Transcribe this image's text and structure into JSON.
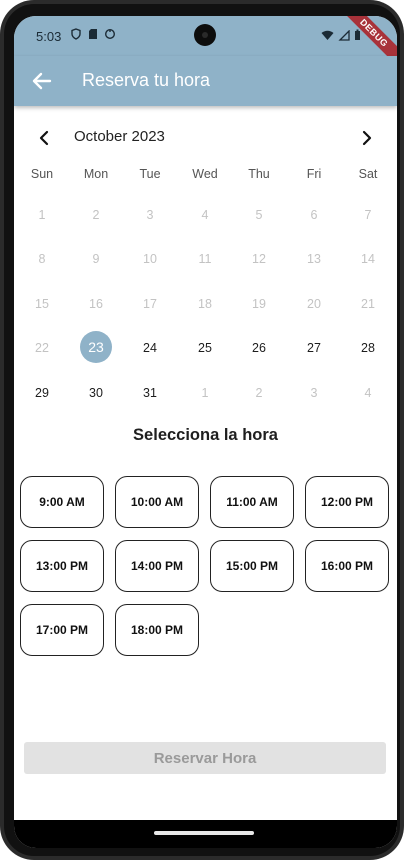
{
  "status_bar": {
    "time": "5:03",
    "debug_label": "DEBUG"
  },
  "app_bar": {
    "title": "Reserva tu hora"
  },
  "calendar": {
    "month_label": "October 2023",
    "weekdays": [
      "Sun",
      "Mon",
      "Tue",
      "Wed",
      "Thu",
      "Fri",
      "Sat"
    ],
    "weeks": [
      [
        {
          "d": "1",
          "a": false
        },
        {
          "d": "2",
          "a": false
        },
        {
          "d": "3",
          "a": false
        },
        {
          "d": "4",
          "a": false
        },
        {
          "d": "5",
          "a": false
        },
        {
          "d": "6",
          "a": false
        },
        {
          "d": "7",
          "a": false
        }
      ],
      [
        {
          "d": "8",
          "a": false
        },
        {
          "d": "9",
          "a": false
        },
        {
          "d": "10",
          "a": false
        },
        {
          "d": "11",
          "a": false
        },
        {
          "d": "12",
          "a": false
        },
        {
          "d": "13",
          "a": false
        },
        {
          "d": "14",
          "a": false
        }
      ],
      [
        {
          "d": "15",
          "a": false
        },
        {
          "d": "16",
          "a": false
        },
        {
          "d": "17",
          "a": false
        },
        {
          "d": "18",
          "a": false
        },
        {
          "d": "19",
          "a": false
        },
        {
          "d": "20",
          "a": false
        },
        {
          "d": "21",
          "a": false
        }
      ],
      [
        {
          "d": "22",
          "a": false
        },
        {
          "d": "23",
          "a": true,
          "selected": true
        },
        {
          "d": "24",
          "a": true
        },
        {
          "d": "25",
          "a": true
        },
        {
          "d": "26",
          "a": true
        },
        {
          "d": "27",
          "a": true
        },
        {
          "d": "28",
          "a": true
        }
      ],
      [
        {
          "d": "29",
          "a": true
        },
        {
          "d": "30",
          "a": true
        },
        {
          "d": "31",
          "a": true
        },
        {
          "d": "1",
          "a": false
        },
        {
          "d": "2",
          "a": false
        },
        {
          "d": "3",
          "a": false
        },
        {
          "d": "4",
          "a": false
        }
      ]
    ],
    "selected_day": "23"
  },
  "time_section": {
    "title": "Selecciona la hora",
    "slots": [
      "9:00 AM",
      "10:00 AM",
      "11:00 AM",
      "12:00 PM",
      "13:00 PM",
      "14:00 PM",
      "15:00 PM",
      "16:00 PM",
      "17:00 PM",
      "18:00 PM"
    ]
  },
  "reserve_button": {
    "label": "Reservar Hora",
    "enabled": false
  },
  "colors": {
    "primary": "#8fb2c8",
    "selected_day_bg": "#8fb2c8",
    "disabled_button_bg": "#e2e2e2",
    "disabled_button_text": "#9a9a9a"
  },
  "icons": {
    "back": "arrow-left-icon",
    "prev_month": "chevron-left-icon",
    "next_month": "chevron-right-icon"
  }
}
